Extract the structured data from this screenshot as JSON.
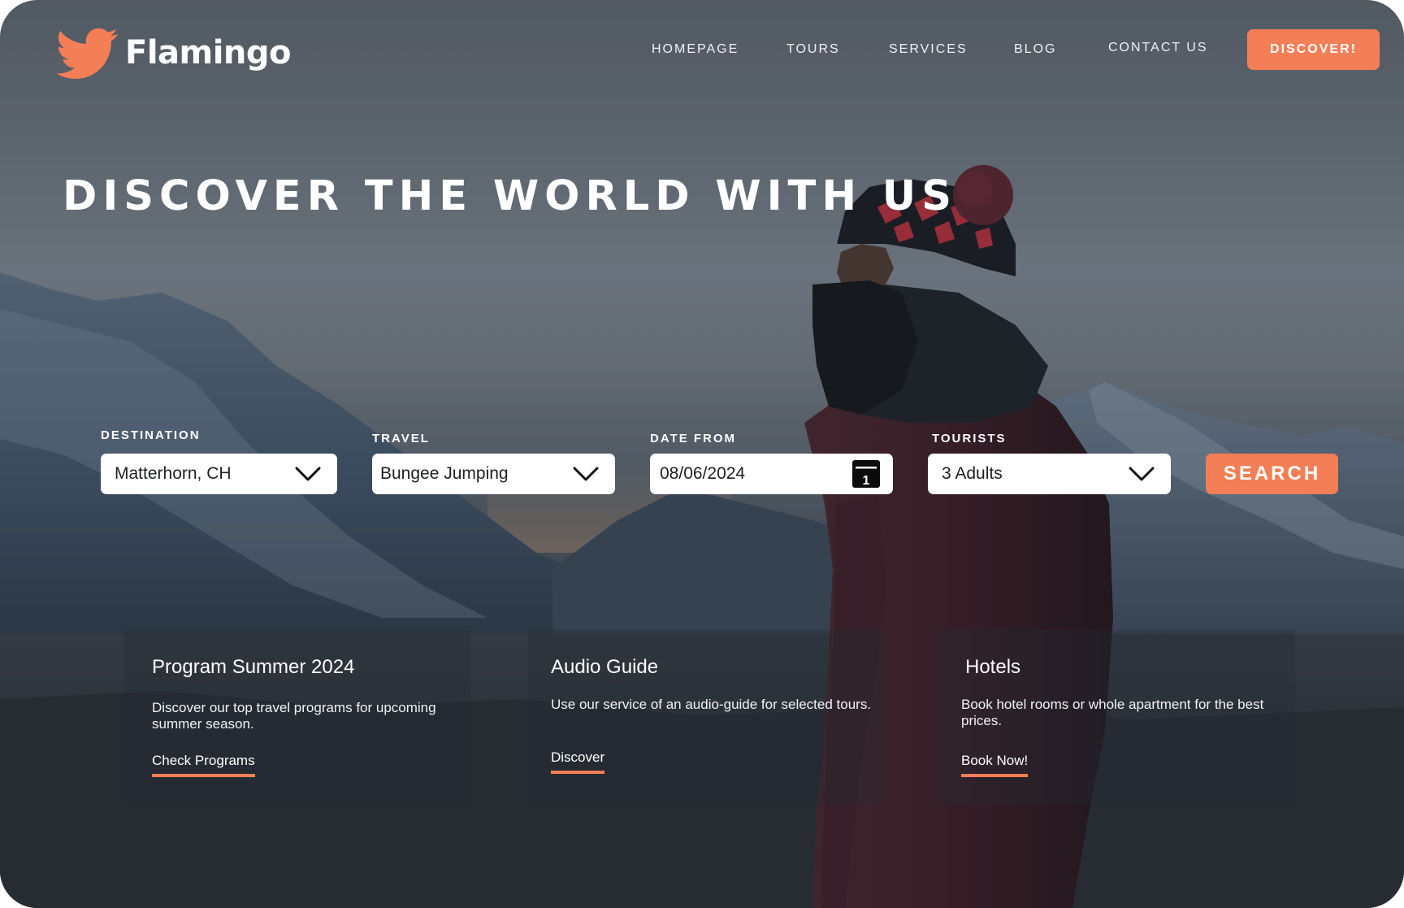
{
  "brand": {
    "name": "Flamingo",
    "logo_icon": "bird-icon",
    "accent_color": "#f47e55"
  },
  "nav": {
    "items": [
      "HOMEPAGE",
      "TOURS",
      "SERVICES",
      "BLOG",
      "CONTACT US"
    ],
    "cta_label": "DISCOVER!"
  },
  "hero": {
    "title": "DISCOVER THE WORLD WITH US"
  },
  "search": {
    "destination": {
      "label": "DESTINATION",
      "value": "Matterhorn, CH",
      "icon": "chevron-down-icon"
    },
    "travel": {
      "label": "TRAVEL",
      "value": "Bungee Jumping",
      "icon": "chevron-down-icon"
    },
    "date_from": {
      "label": "DATE FROM",
      "value": "08/06/2024",
      "icon": "calendar-icon",
      "calendar_day": "1"
    },
    "tourists": {
      "label": "TOURISTS",
      "value": "3 Adults",
      "icon": "chevron-down-icon"
    },
    "button_label": "SEARCH"
  },
  "cards": [
    {
      "title": "Program Summer 2024",
      "text": "Discover our top travel programs for upcoming summer season.",
      "link": "Check Programs"
    },
    {
      "title": "Audio Guide",
      "text": "Use our service of an audio-guide for selected tours.",
      "link": "Discover"
    },
    {
      "title": "Hotels",
      "text": "Book hotel rooms or whole apartment for the best prices.",
      "link": "Book Now!"
    }
  ]
}
